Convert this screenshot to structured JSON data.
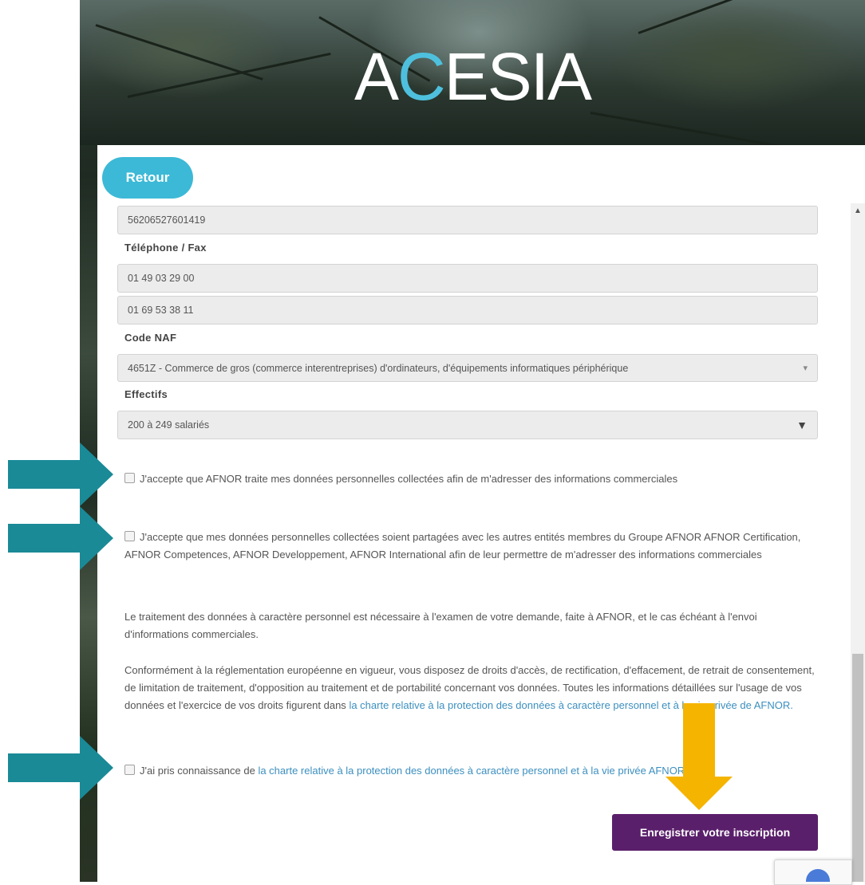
{
  "header": {
    "logo_pre": "A",
    "logo_c": "C",
    "logo_post": "ESIA"
  },
  "nav": {
    "back_label": "Retour"
  },
  "form": {
    "siret_value": "56206527601419",
    "phone_fax_label": "Téléphone / Fax",
    "phone_value": "01 49 03 29 00",
    "fax_value": "01 69 53 38 11",
    "naf_label": "Code NAF",
    "naf_selected": "4651Z - Commerce de gros (commerce interentreprises) d'ordinateurs, d'équipements informatiques périphérique",
    "effectifs_label": "Effectifs",
    "effectifs_selected": "200 à 249 salariés"
  },
  "consents": {
    "consent1": "J'accepte que AFNOR traite mes données personnelles collectées afin de m'adresser des informations commerciales",
    "consent2": "J'accepte que mes données personnelles collectées soient partagées avec les autres entités membres du Groupe AFNOR AFNOR Certification, AFNOR Competences, AFNOR Developpement, AFNOR International afin de leur permettre de m'adresser des informations commerciales",
    "info1": "Le traitement des données à caractère personnel est nécessaire à l'examen de votre demande, faite à AFNOR, et le cas échéant à l'envoi d'informations commerciales.",
    "info2_text": "Conformément à la réglementation européenne en vigueur, vous disposez de droits d'accès, de rectification, d'effacement, de retrait de consentement, de limitation de traitement, d'opposition au traitement et de portabilité concernant vos données. Toutes les informations détaillées sur l'usage de vos données et l'exercice de vos droits figurent dans ",
    "info2_link": "la charte relative à la protection des données à caractère personnel et à la vie privée de AFNOR.",
    "consent3_text": "J'ai pris connaissance de ",
    "consent3_link": "la charte relative à la protection des données à caractère personnel et à la vie privée AFNOR.",
    "required_mark": "*"
  },
  "actions": {
    "submit_label": "Enregistrer votre inscription"
  },
  "colors": {
    "accent_blue": "#3cb9d6",
    "submit_purple": "#5a1f6b",
    "arrow_teal": "#1a8a97",
    "arrow_yellow": "#f5b400",
    "link_blue": "#3c8fbf"
  }
}
